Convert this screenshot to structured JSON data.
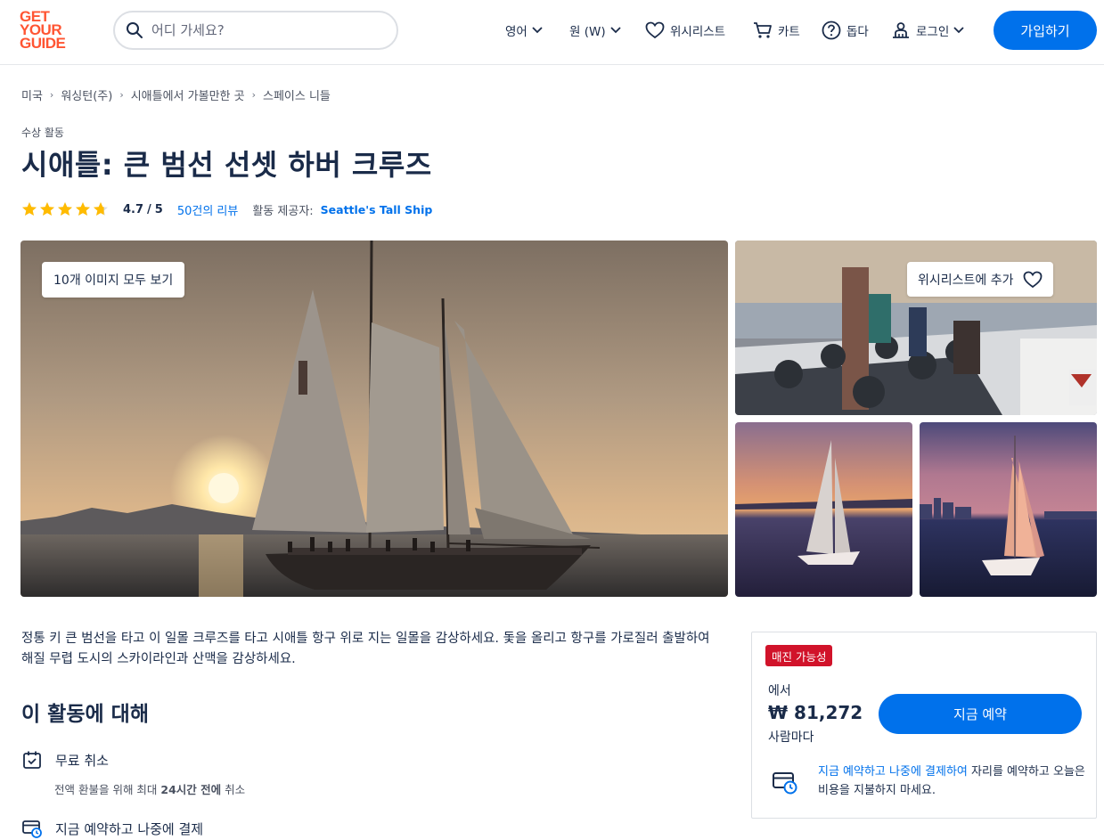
{
  "header": {
    "logo_lines": [
      "GET",
      "YOUR",
      "GUIDE"
    ],
    "search_placeholder": "어디 가세요?",
    "language_label": "영어",
    "currency_label": "원 (W)",
    "wishlist_label": "위시리스트",
    "cart_label": "카트",
    "help_label": "돕다",
    "login_label": "로그인",
    "signup_label": "가입하기"
  },
  "breadcrumb": [
    "미국",
    "워싱턴(주)",
    "시애틀에서 가볼만한 곳",
    "스페이스 니들"
  ],
  "activity": {
    "category": "수상 활동",
    "title": "시애틀: 큰 범선 선셋 하버 크루즈",
    "rating_value": "4.7",
    "rating_max": "5",
    "stars": 4.7,
    "reviews_label": "50건의 리뷰",
    "provider_label": "활동 제공자:",
    "provider_name": "Seattle's Tall Ship"
  },
  "gallery": {
    "view_all_label": "10개 이미지 모두 보기",
    "wishlist_add_label": "위시리스트에 추가"
  },
  "description": "정통 키 큰 범선을 타고 이 일몰 크루즈를 타고 시애틀 항구 위로 지는 일몰을 감상하세요. 돛을 올리고 항구를 가로질러 출발하여 해질 무렵 도시의 스카이라인과 산맥을 감상하세요.",
  "about": {
    "heading": "이 활동에 대해",
    "features": [
      {
        "title": "무료 취소",
        "subtitle_pre": "전액 환불을 위해 최대 ",
        "subtitle_bold": "24시간 전에",
        "subtitle_post": " 취소"
      },
      {
        "title": "지금 예약하고 나중에 결제"
      }
    ]
  },
  "booking": {
    "badge": "매진 가능성",
    "from_label": "에서",
    "price": "₩ 81,272",
    "per_person": "사람마다",
    "book_button": "지금 예약",
    "note_highlight": "지금 예약하고 나중에 결제하여",
    "note_rest": " 자리를 예약하고 오늘은 비용을 지불하지 마세요."
  },
  "colors": {
    "primary_blue": "#0071eb",
    "brand_orange": "#ff5533",
    "badge_red": "#d1132a",
    "star_yellow": "#ffbb00",
    "text_dark": "#1a2b49"
  }
}
